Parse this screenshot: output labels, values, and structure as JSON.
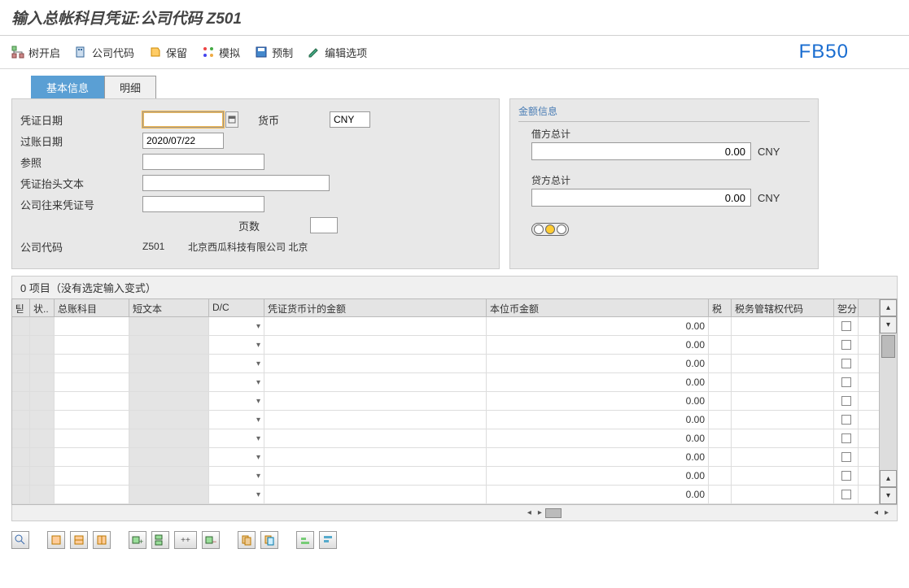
{
  "title": "输入总帐科目凭证:公司代码 Z501",
  "tcode": "FB50",
  "toolbar": {
    "tree": "树开启",
    "company": "公司代码",
    "hold": "保留",
    "simulate": "模拟",
    "park": "预制",
    "edit": "编辑选项"
  },
  "tabs": {
    "basic": "基本信息",
    "detail": "明细"
  },
  "fields": {
    "doc_date_lbl": "凭证日期",
    "doc_date": "",
    "currency_lbl": "货币",
    "currency": "CNY",
    "post_date_lbl": "过账日期",
    "post_date": "2020/07/22",
    "ref_lbl": "参照",
    "ref": "",
    "header_txt_lbl": "凭证抬头文本",
    "header_txt": "",
    "interco_lbl": "公司往来凭证号",
    "interco": "",
    "pages_lbl": "页数",
    "pages": "",
    "cc_lbl": "公司代码",
    "cc_code": "Z501",
    "cc_name": "北京西瓜科技有限公司 北京"
  },
  "amount": {
    "section": "金额信息",
    "debit_lbl": "借方总计",
    "debit": "0.00",
    "debit_cur": "CNY",
    "credit_lbl": "贷方总计",
    "credit": "0.00",
    "credit_cur": "CNY"
  },
  "grid": {
    "title": "0 项目（没有选定输入变式）",
    "cols": {
      "sel": "틷",
      "status": "状..",
      "account": "总账科目",
      "text": "短文本",
      "dc": "D/C",
      "amt1": "凭证货币计的金额",
      "amt2": "本位币金额",
      "tax": "税",
      "taxj": "税务管辖权代码",
      "part": "乫分"
    },
    "default_amt2": "0.00",
    "rows": 10
  },
  "bottom_icons": [
    "find",
    "layout-a",
    "layout-b",
    "layout-c",
    "add-row",
    "add-rows",
    "plus-plus",
    "del-row",
    "copy",
    "paste",
    "sort-a",
    "sort-b"
  ]
}
